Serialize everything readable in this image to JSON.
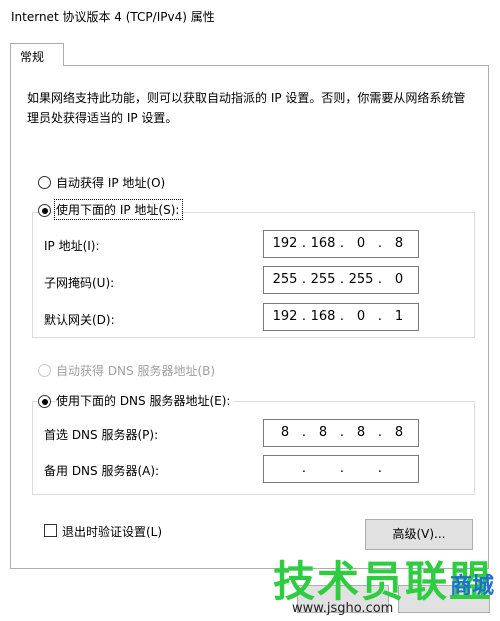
{
  "window": {
    "title": "Internet 协议版本 4 (TCP/IPv4) 属性"
  },
  "tabs": [
    {
      "label": "常规"
    }
  ],
  "description": "如果网络支持此功能，则可以获取自动指派的 IP 设置。否则，你需要从网络系统管理员处获得适当的 IP 设置。",
  "ip_section": {
    "auto_label": "自动获得 IP 地址(O)",
    "manual_label": "使用下面的 IP 地址(S):",
    "selected": "manual",
    "fields": [
      {
        "label": "IP 地址(I):",
        "octets": [
          "192",
          "168",
          "0",
          "8"
        ]
      },
      {
        "label": "子网掩码(U):",
        "octets": [
          "255",
          "255",
          "255",
          "0"
        ]
      },
      {
        "label": "默认网关(D):",
        "octets": [
          "192",
          "168",
          "0",
          "1"
        ]
      }
    ]
  },
  "dns_section": {
    "auto_label": "自动获得 DNS 服务器地址(B)",
    "manual_label": "使用下面的 DNS 服务器地址(E):",
    "selected": "manual",
    "fields": [
      {
        "label": "首选 DNS 服务器(P):",
        "octets": [
          "8",
          "8",
          "8",
          "8"
        ]
      },
      {
        "label": "备用 DNS 服务器(A):",
        "octets": [
          "",
          "",
          "",
          ""
        ]
      }
    ]
  },
  "validate_label": "退出时验证设置(L)",
  "advanced_label": "高级(V)...",
  "watermark": {
    "brand": "技术员联盟",
    "suffix": "商城",
    "url": "www.jsgho.com"
  }
}
